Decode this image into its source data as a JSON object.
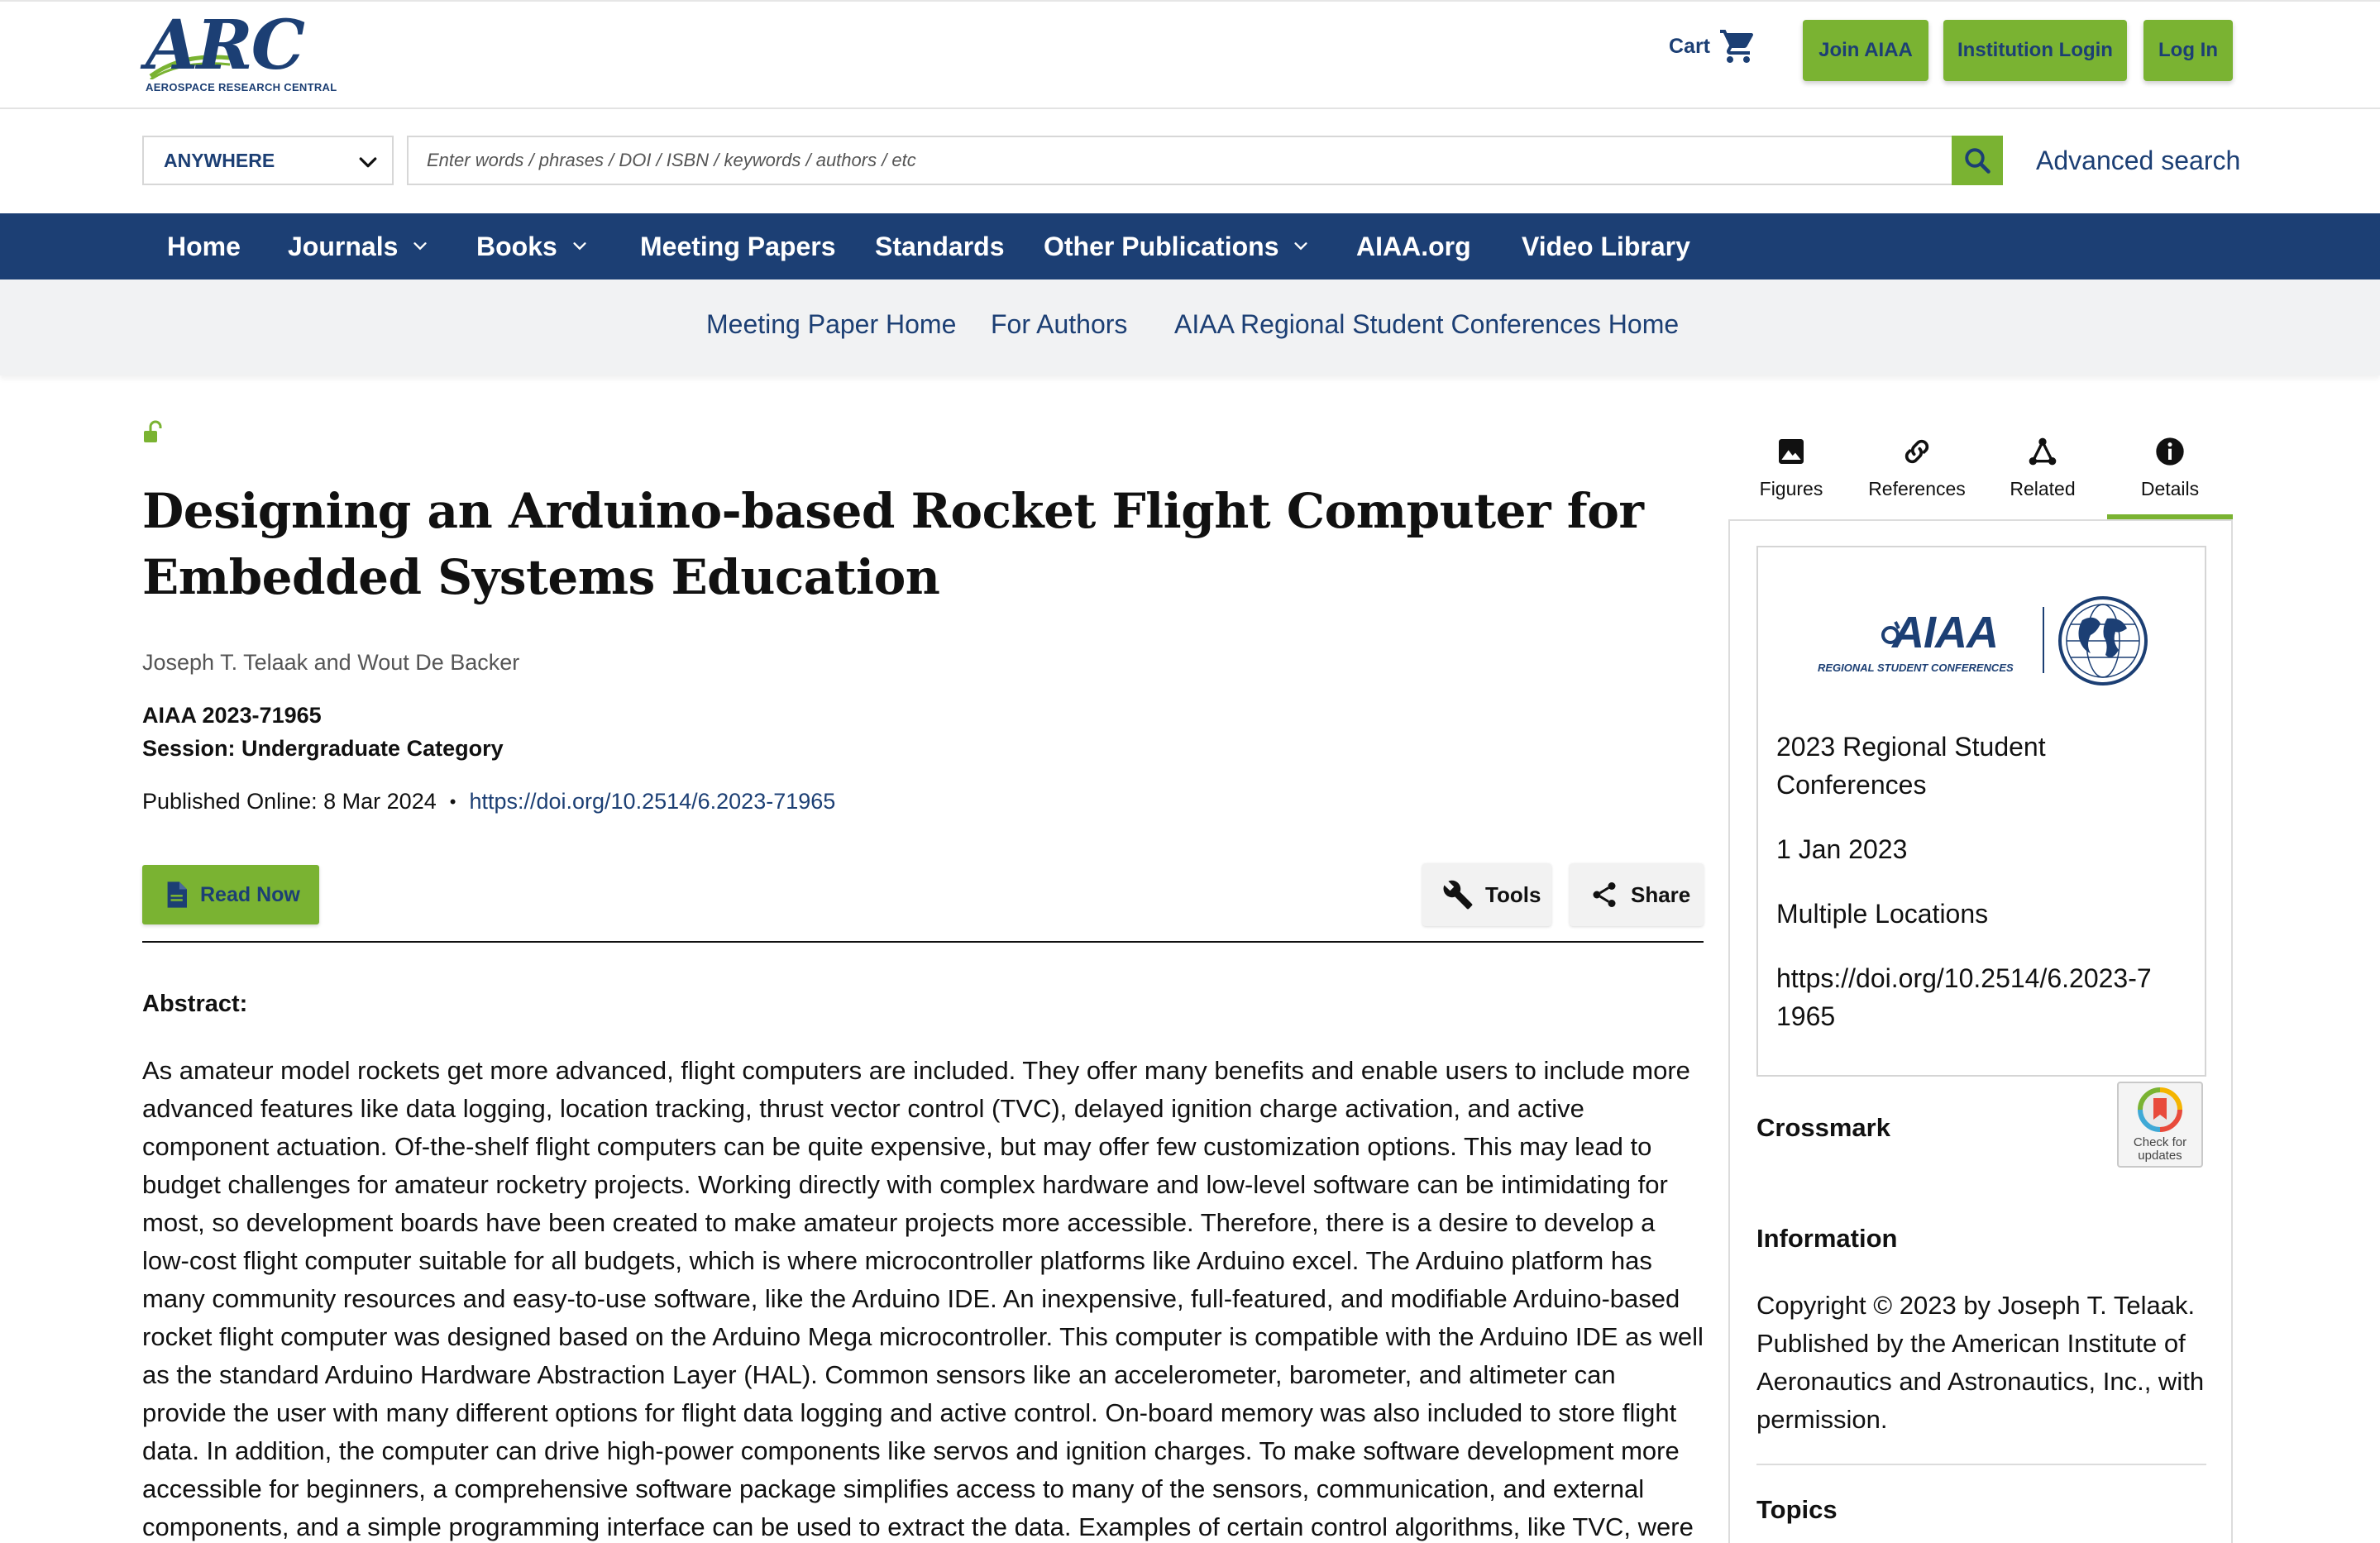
{
  "header": {
    "logo_text": "ARC",
    "logo_subtitle": "AEROSPACE RESEARCH CENTRAL",
    "cart_label": "Cart",
    "join_label": "Join AIAA",
    "institution_label": "Institution Login",
    "login_label": "Log In"
  },
  "search": {
    "scope_value": "ANYWHERE",
    "placeholder": "Enter words / phrases / DOI / ISBN / keywords / authors / etc",
    "advanced_label": "Advanced search"
  },
  "nav": {
    "items": [
      {
        "label": "Home",
        "dropdown": false
      },
      {
        "label": "Journals",
        "dropdown": true
      },
      {
        "label": "Books",
        "dropdown": true
      },
      {
        "label": "Meeting Papers",
        "dropdown": false
      },
      {
        "label": "Standards",
        "dropdown": false
      },
      {
        "label": "Other Publications",
        "dropdown": true
      },
      {
        "label": "AIAA.org",
        "dropdown": false
      },
      {
        "label": "Video Library",
        "dropdown": false
      }
    ]
  },
  "subnav": {
    "items": [
      {
        "label": "Meeting Paper Home"
      },
      {
        "label": "For Authors"
      },
      {
        "label": "AIAA Regional Student Conferences Home"
      }
    ]
  },
  "article": {
    "title": "Designing an Arduino-based Rocket Flight Computer for Embedded Systems Education",
    "authors": "Joseph T. Telaak and Wout De Backer",
    "paper_id": "AIAA 2023-71965",
    "session": "Session: Undergraduate Category",
    "published": "Published Online: 8 Mar 2024",
    "doi": "https://doi.org/10.2514/6.2023-71965",
    "read_now_label": "Read Now",
    "tools_label": "Tools",
    "share_label": "Share",
    "abstract_heading": "Abstract:",
    "abstract_text": "As amateur model rockets get more advanced, flight computers are included. They offer many benefits and enable users to include more advanced features like data logging, location tracking, thrust vector control (TVC), delayed ignition charge activation, and active component actuation. Of-the-shelf flight computers can be quite expensive, but may offer few customization options. This may lead to budget challenges for amateur rocketry projects. Working directly with complex hardware and low-level software can be intimidating for most, so development boards have been created to make amateur projects more accessible. Therefore, there is a desire to develop a low-cost flight computer suitable for all budgets, which is where microcontroller platforms like Arduino excel. The Arduino platform has many community resources and easy-to-use software, like the Arduino IDE. An inexpensive, full-featured, and modifiable Arduino-based rocket flight computer was designed based on the Arduino Mega microcontroller. This computer is compatible with the Arduino IDE as well as the standard Arduino Hardware Abstraction Layer (HAL). Common sensors like an accelerometer, barometer, and altimeter can provide the user with many different options for flight data logging and active control. On-board memory was also included to store flight data. In addition, the computer can drive high-power components like servos and ignition charges. To make software development more accessible for beginners, a comprehensive software package simplifies access to many of the sensors, communication, and external components, and a simple programming interface can be used to extract the data. Examples of certain control algorithms, like TVC, were"
  },
  "sidebar": {
    "tabs": [
      {
        "label": "Figures",
        "icon": "image-icon"
      },
      {
        "label": "References",
        "icon": "link-icon"
      },
      {
        "label": "Related",
        "icon": "network-icon"
      },
      {
        "label": "Details",
        "icon": "info-icon",
        "active": true
      }
    ],
    "conference_logo_text": "AIAA",
    "conference_logo_subtitle": "REGIONAL STUDENT CONFERENCES",
    "conference_name": "2023 Regional Student Conferences",
    "conference_date": "1 Jan 2023",
    "conference_location": "Multiple Locations",
    "conference_doi": "https://doi.org/10.2514/6.2023-71965",
    "crossmark_label": "Crossmark",
    "crossmark_badge_text": "Check for updates",
    "information_heading": "Information",
    "information_text": "Copyright © 2023 by Joseph T. Telaak. Published by the American Institute of Aeronautics and Astronautics, Inc., with permission.",
    "topics_heading": "Topics"
  },
  "colors": {
    "brand_navy": "#1c3f74",
    "brand_green": "#7ab332"
  }
}
